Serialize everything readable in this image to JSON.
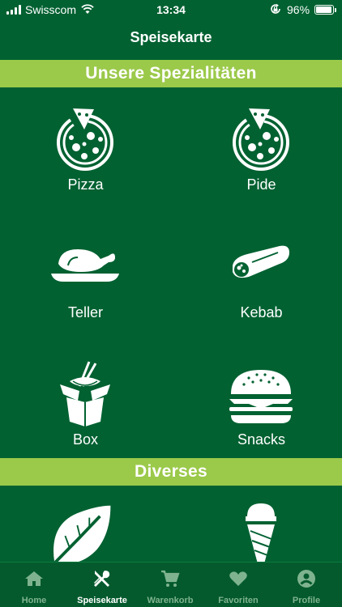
{
  "status_bar": {
    "carrier": "Swisscom",
    "time": "13:34",
    "battery_percent": "96%",
    "battery_level": 0.96
  },
  "nav": {
    "title": "Speisekarte"
  },
  "sections": [
    {
      "title": "Unsere Spezialitäten",
      "items": [
        {
          "label": "Pizza",
          "icon": "pizza-icon"
        },
        {
          "label": "Pide",
          "icon": "pide-icon"
        },
        {
          "label": "Teller",
          "icon": "teller-icon"
        },
        {
          "label": "Kebab",
          "icon": "kebab-icon"
        },
        {
          "label": "Box",
          "icon": "box-icon"
        },
        {
          "label": "Snacks",
          "icon": "snacks-icon"
        }
      ]
    },
    {
      "title": "Diverses",
      "items": [
        {
          "label": "",
          "icon": "leaf-icon"
        },
        {
          "label": "",
          "icon": "ice-cream-icon"
        }
      ]
    }
  ],
  "tabbar": {
    "active": "Speisekarte",
    "items": [
      {
        "label": "Home",
        "icon": "home-icon"
      },
      {
        "label": "Speisekarte",
        "icon": "utensils-icon"
      },
      {
        "label": "Warenkorb",
        "icon": "cart-icon"
      },
      {
        "label": "Favoriten",
        "icon": "heart-icon"
      },
      {
        "label": "Profile",
        "icon": "profile-icon"
      }
    ]
  },
  "colors": {
    "background": "#016131",
    "banner": "#9bc94a",
    "tabbar": "#045a2d",
    "tab_inactive": "#7fb38f",
    "tab_active": "#ffffff"
  }
}
